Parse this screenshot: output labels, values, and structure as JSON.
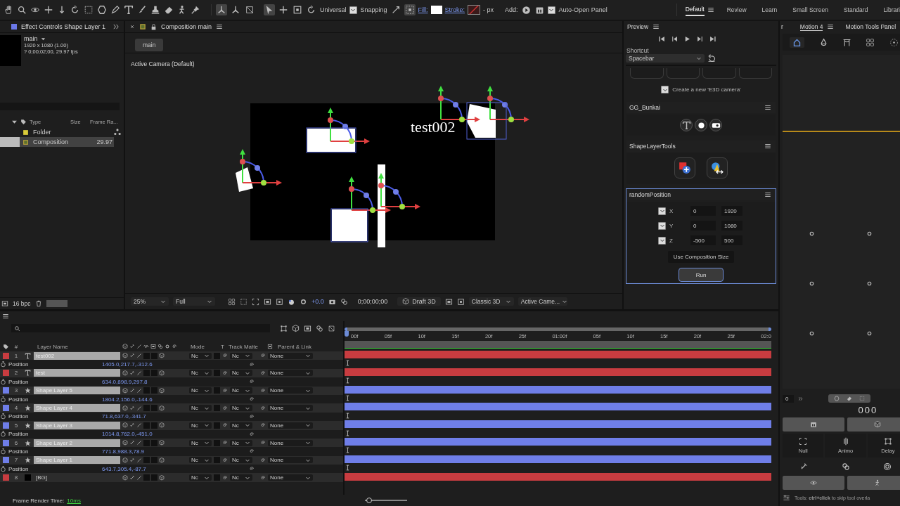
{
  "toolbar": {
    "axis_mode": "Universal",
    "snapping": {
      "label": "Snapping",
      "checked": true
    },
    "fill_label": "Fill:",
    "stroke_label": "Stroke:",
    "stroke_width": "- px",
    "add_label": "Add:",
    "auto_open": {
      "label": "Auto-Open Panel",
      "checked": true
    }
  },
  "workspaces": [
    {
      "label": "Default",
      "selected": true
    },
    {
      "label": "Review",
      "selected": false
    },
    {
      "label": "Learn",
      "selected": false
    },
    {
      "label": "Small Screen",
      "selected": false
    },
    {
      "label": "Standard",
      "selected": false
    },
    {
      "label": "Librari",
      "selected": false
    }
  ],
  "project_panel": {
    "tab": "Effect Controls Shape Layer 1",
    "comp_name": "main",
    "comp_size": "1920 x 1080 (1.00)",
    "comp_duration": "? 0;00;02;00, 29.97 fps",
    "columns": [
      "Type",
      "Size",
      "Frame Ra..."
    ],
    "items": [
      {
        "kind": "folder",
        "type": "Folder",
        "selected": false
      },
      {
        "kind": "composition",
        "type": "Composition",
        "frame_rate": "29.97",
        "selected": true
      }
    ],
    "bit_depth": "16 bpc"
  },
  "composition": {
    "tab": "Composition main",
    "breadcrumb": "main",
    "camera": "Active Camera (Default)",
    "layer_text": "test002",
    "footer": {
      "zoom": "25%",
      "resolution": "Full",
      "exposure": "+0.0",
      "timecode": "0;00;00;00",
      "draft_3d": "Draft 3D",
      "renderer": "Classic 3D",
      "view": "Active Came..."
    }
  },
  "preview": {
    "title": "Preview",
    "shortcut_label": "Shortcut",
    "shortcut": "Spacebar"
  },
  "e3d": {
    "camera_option": {
      "label": "Create a new 'E3D camera'",
      "checked": true
    }
  },
  "gg_bunkai": {
    "title": "GG_Bunkai",
    "selected": false
  },
  "shape_layer_tools": {
    "title": "ShapeLayerTools",
    "selected": false
  },
  "random_position": {
    "title": "randomPosition",
    "selected": true,
    "axes": [
      {
        "label": "X",
        "checked": true,
        "min": "0",
        "max": "1920"
      },
      {
        "label": "Y",
        "checked": true,
        "min": "0",
        "max": "1080"
      },
      {
        "label": "Z",
        "checked": true,
        "min": "-500",
        "max": "500"
      }
    ],
    "use_comp_size": "Use Composition Size",
    "run": "Run"
  },
  "motion_panel": {
    "tabs": [
      {
        "label": "r",
        "selected": false
      },
      {
        "label": "Motion 4",
        "selected": true
      },
      {
        "label": "Motion Tools Panel",
        "selected": false
      }
    ],
    "value": "0",
    "readout": "000",
    "tools": [
      "Null",
      "Animo",
      "Delay"
    ],
    "tip": "Tools: **ctrl+click** to skip tool overla"
  },
  "timeline": {
    "columns": {
      "number": "#",
      "name": "Layer Name",
      "mode": "Mode",
      "t": "T",
      "matte": "Track Matte",
      "parent": "Parent & Link"
    },
    "layers": [
      {
        "number": "1",
        "kind": "text",
        "name": "test002",
        "color": "#c83c40",
        "mode": "Nc",
        "matte": "Nc",
        "parent": "None",
        "position": {
          "label": "Position",
          "value": "1405.0,217.7,-312.6"
        }
      },
      {
        "number": "2",
        "kind": "text",
        "name": "test",
        "color": "#c83c40",
        "mode": "Nc",
        "matte": "Nc",
        "parent": "None",
        "position": {
          "label": "Position",
          "value": "634.0,898.9,297.8"
        }
      },
      {
        "number": "3",
        "kind": "shape",
        "name": "Shape Layer 5",
        "color": "#6f7ee8",
        "mode": "Nc",
        "matte": "Nc",
        "parent": "None",
        "position": {
          "label": "Position",
          "value": "1804.2,156.0,-144.6"
        }
      },
      {
        "number": "4",
        "kind": "shape",
        "name": "Shape Layer 4",
        "color": "#6f7ee8",
        "mode": "Nc",
        "matte": "Nc",
        "parent": "None",
        "position": {
          "label": "Position",
          "value": "71.8,637.0,-341.7"
        }
      },
      {
        "number": "5",
        "kind": "shape",
        "name": "Shape Layer 3",
        "color": "#6f7ee8",
        "mode": "Nc",
        "matte": "Nc",
        "parent": "None",
        "position": {
          "label": "Position",
          "value": "1014.8,762.0,-451.0"
        }
      },
      {
        "number": "6",
        "kind": "shape",
        "name": "Shape Layer 2",
        "color": "#6f7ee8",
        "mode": "Nc",
        "matte": "Nc",
        "parent": "None",
        "position": {
          "label": "Position",
          "value": "771.8,988.3,78.9"
        }
      },
      {
        "number": "7",
        "kind": "shape",
        "name": "Shape Layer 1",
        "color": "#6f7ee8",
        "mode": "Nc",
        "matte": "Nc",
        "parent": "None",
        "position": {
          "label": "Position",
          "value": "643.7,305.4,-87.7"
        }
      },
      {
        "number": "8",
        "kind": "solid",
        "name": "[BG]",
        "color": "#c83c40",
        "mode": "Nc",
        "matte": "Nc",
        "parent": "None"
      }
    ],
    "ruler": [
      "00f",
      "05f",
      "10f",
      "15f",
      "20f",
      "25f",
      "01:00f",
      "05f",
      "10f",
      "15f",
      "20f",
      "25f",
      "02:0"
    ],
    "render_time_label": "Frame Render Time:",
    "render_time": "10ms",
    "zoom": {
      "level": 0.1
    }
  }
}
